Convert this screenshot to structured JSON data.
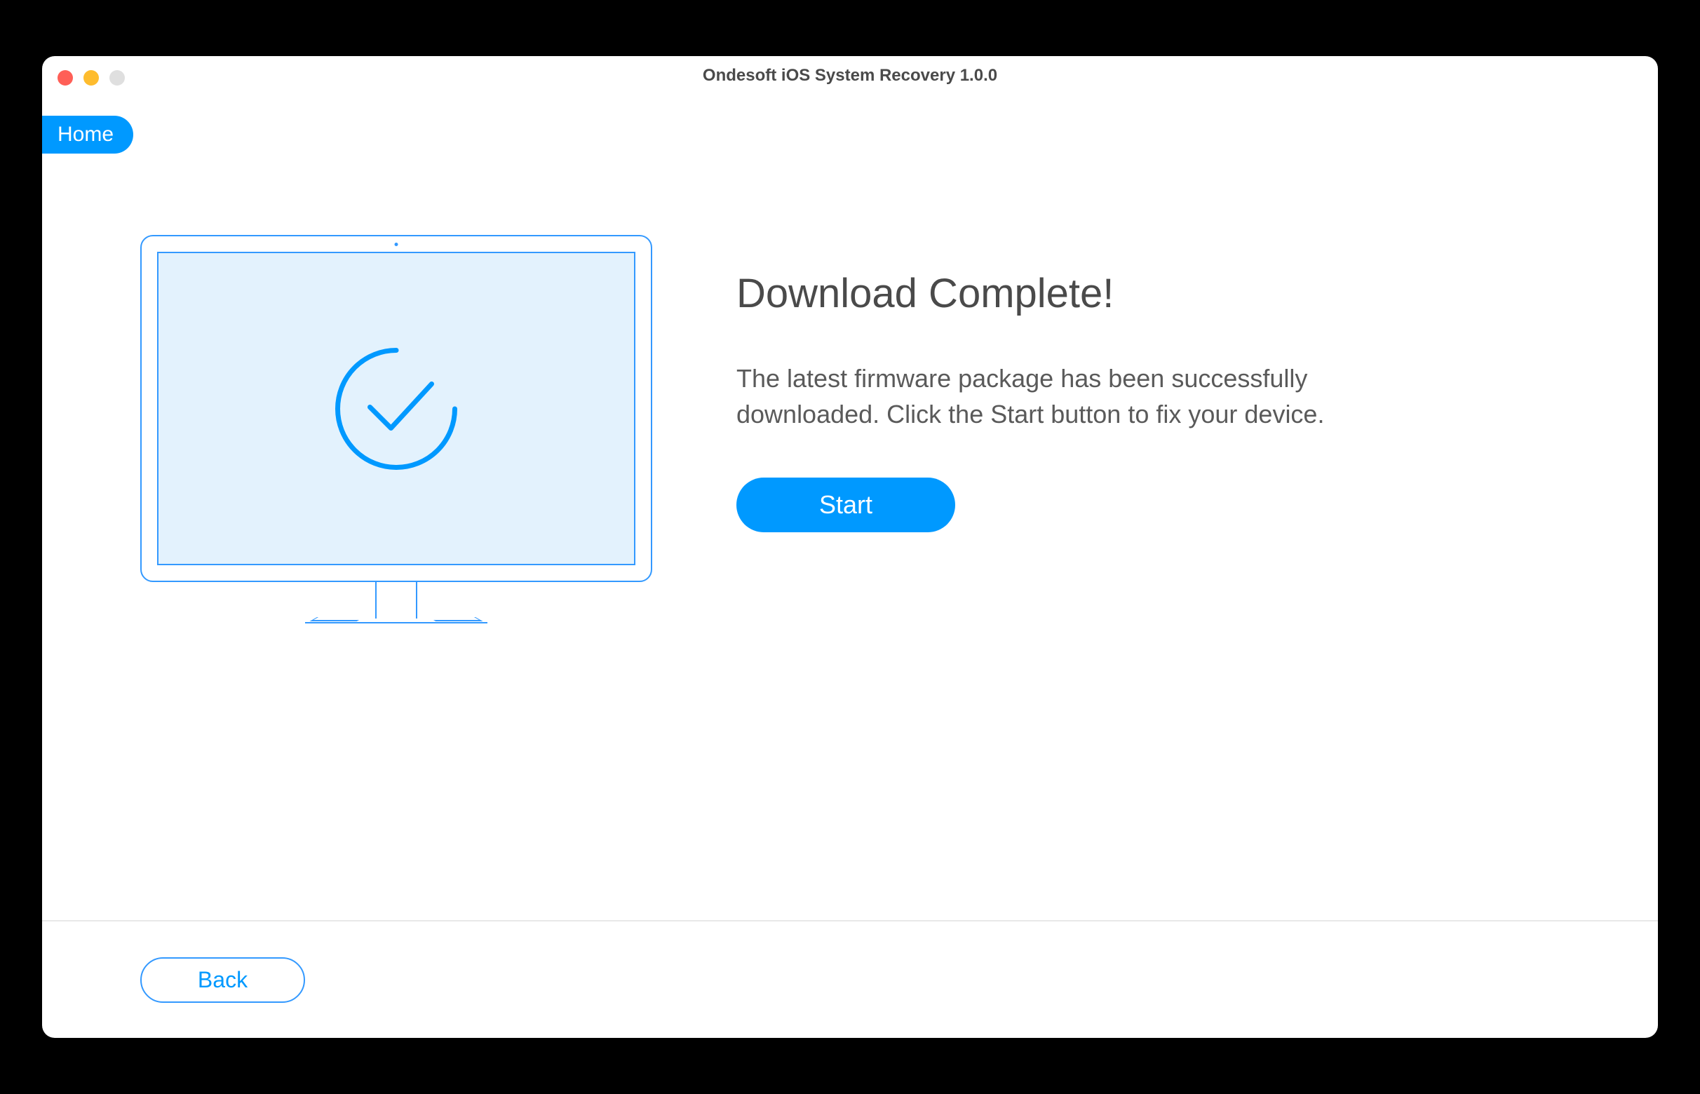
{
  "window": {
    "title": "Ondesoft iOS System Recovery 1.0.0"
  },
  "nav": {
    "home_label": "Home"
  },
  "main": {
    "heading": "Download Complete!",
    "description": "The latest firmware package has been successfully downloaded. Click the Start button to fix your device.",
    "start_label": "Start"
  },
  "footer": {
    "back_label": "Back"
  }
}
